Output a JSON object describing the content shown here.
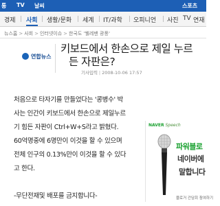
{
  "topbar": {
    "items": [
      {
        "label": "통"
      },
      {
        "label": "TV"
      },
      {
        "label": "날씨"
      },
      {
        "label": "스포츠"
      }
    ]
  },
  "nav": {
    "items": [
      {
        "label": "경제"
      },
      {
        "label": "사회"
      },
      {
        "label": "생활/문화"
      },
      {
        "label": "세계"
      },
      {
        "label": "IT/과학"
      },
      {
        "label": "오피니언"
      },
      {
        "label": "사진"
      },
      {
        "label": "TV"
      },
      {
        "label": "연재"
      }
    ],
    "active": "사회"
  },
  "breadcrumb": {
    "items": [
      "뉴스홈",
      "사회",
      "인터넷이슈",
      "한국도 '웰레밴 광풍'"
    ]
  },
  "source": {
    "name": "연합뉴스"
  },
  "article": {
    "headline_line1": "키보드에서 한손으로 제일 누르",
    "headline_line2": "든 자판은?",
    "meta_label": "기사입력",
    "date": "2008-10-06 17:57",
    "body": [
      "처음으로 타자기를 만들었다는 '콩병수' 박",
      "사는 인간이 키보드에서 한손으로 제일누르",
      "기 힘든 자판이 Ctrl+W+S라고 밝혔다.",
      "60억명중에 6명만이 이것을 할 수 있으며",
      "전체 인구의 0.13%만이 이것을 할 수 있다",
      "고 한다.",
      "",
      "-무단전재및 배포를 금지합니다-"
    ]
  },
  "ad": {
    "brand": "NAVER",
    "brand_script": "Speech",
    "line1": "파워블로",
    "line2": "네이버에",
    "line3": "말합니다",
    "footer": "블로거 간담회 참여하기",
    "accent": "#1aa130"
  },
  "colors": {
    "topbar": "#1d5fb5",
    "link": "#1d5fb5"
  }
}
